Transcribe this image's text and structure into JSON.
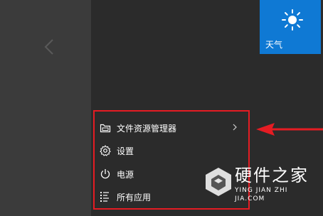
{
  "tiles": {
    "weather_label": "天气"
  },
  "menu": {
    "items": [
      {
        "label": "文件资源管理器",
        "icon": "file-explorer-icon"
      },
      {
        "label": "设置",
        "icon": "gear-icon"
      },
      {
        "label": "电源",
        "icon": "power-icon"
      },
      {
        "label": "所有应用",
        "icon": "all-apps-list-icon"
      }
    ]
  },
  "watermark": {
    "name": "硬件之家",
    "url": "YING JIAN ZHI JIA.COM"
  },
  "colors": {
    "accent": "#0f79d4",
    "highlight": "#e51c23",
    "panel": "#2b2b2b",
    "background": "#3b3b3b"
  }
}
